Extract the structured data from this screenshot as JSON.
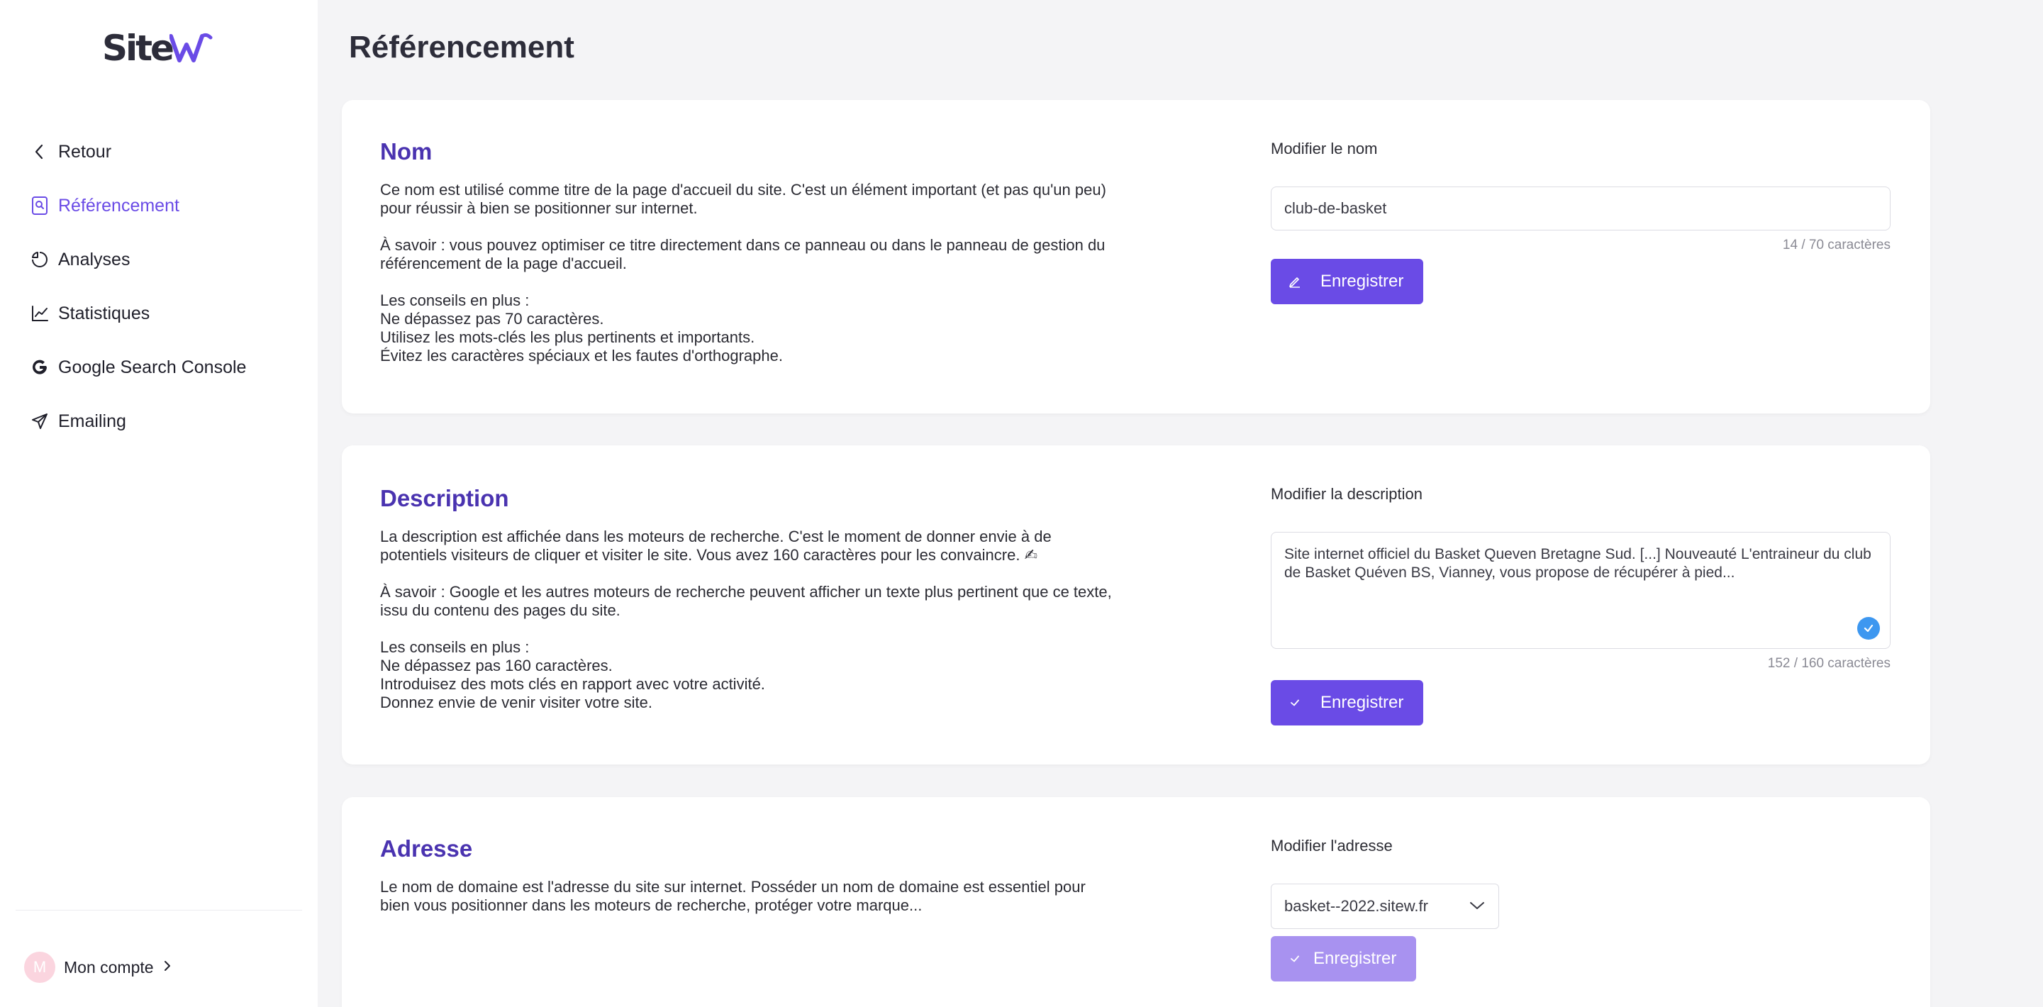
{
  "sidebar": {
    "logo": "Site",
    "items": [
      {
        "label": "Retour",
        "icon": "chevron-left-icon"
      },
      {
        "label": "Référencement",
        "icon": "search-doc-icon",
        "active": true
      },
      {
        "label": "Analyses",
        "icon": "analytics-icon"
      },
      {
        "label": "Statistiques",
        "icon": "chart-line-icon"
      },
      {
        "label": "Google Search Console",
        "icon": "google-icon"
      },
      {
        "label": "Emailing",
        "icon": "paper-plane-icon"
      }
    ],
    "account": {
      "initial": "M",
      "label": "Mon compte"
    }
  },
  "page": {
    "title": "Référencement"
  },
  "nom": {
    "title": "Nom",
    "paragraphs": [
      "Ce nom est utilisé comme titre de la page d'accueil du site. C'est un élément important (et pas qu'un peu) pour réussir à bien se positionner sur internet.",
      "À savoir : vous pouvez optimiser ce titre directement dans ce panneau ou dans le panneau de gestion du référencement de la page d'accueil.",
      "Les conseils en plus :\nNe dépassez pas 70 caractères.\nUtilisez les mots-clés les plus pertinents et importants.\nÉvitez les caractères spéciaux et les fautes d'orthographe."
    ],
    "field_label": "Modifier le nom",
    "value": "club-de-basket",
    "counter": "14 / 70 caractères",
    "button": "Enregistrer"
  },
  "description": {
    "title": "Description",
    "paragraphs": [
      "La description est affichée dans les moteurs de recherche. C'est le moment de donner envie à de potentiels visiteurs de cliquer et visiter le site. Vous avez 160 caractères pour les convaincre. ✍",
      "À savoir : Google et les autres moteurs de recherche peuvent afficher un texte plus pertinent que ce texte, issu du contenu des pages du site.",
      "Les conseils en plus :\nNe dépassez pas 160 caractères.\nIntroduisez des mots clés en rapport avec votre activité.\nDonnez envie de venir visiter votre site."
    ],
    "field_label": "Modifier la description",
    "value": "Site internet officiel du Basket Queven Bretagne Sud. [...] Nouveauté L'entraineur du club de Basket Quéven BS, Vianney, vous propose de récupérer à pied...",
    "counter": "152 / 160 caractères",
    "button": "Enregistrer"
  },
  "adresse": {
    "title": "Adresse",
    "paragraphs": [
      "Le nom de domaine est l'adresse du site sur internet. Posséder un nom de domaine est essentiel pour bien vous positionner dans les moteurs de recherche, protéger votre marque..."
    ],
    "field_label": "Modifier l'adresse",
    "selected": "basket--2022.sitew.fr",
    "button": "Enregistrer"
  },
  "colors": {
    "accent": "#6a4be6",
    "title": "#4a33b0",
    "check": "#3d97f0"
  }
}
